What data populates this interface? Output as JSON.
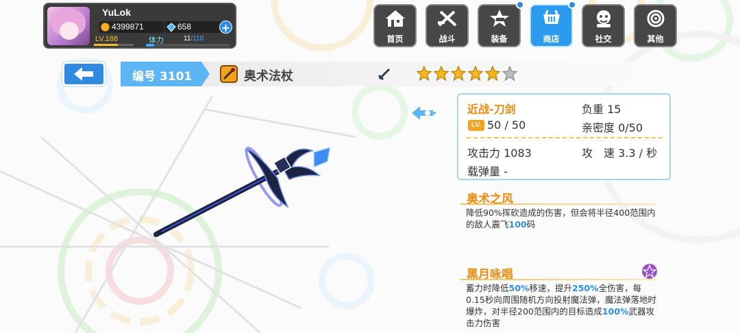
{
  "player": {
    "name": "YuLok",
    "gold": "4399871",
    "gems": "658",
    "level": "LV.188",
    "level_progress": 0.6,
    "stamina_label": "体力",
    "stamina_current": "11",
    "stamina_max": "/110",
    "stamina_progress": 0.1
  },
  "nav": [
    {
      "label": "首页",
      "icon": "home-icon"
    },
    {
      "label": "战斗",
      "icon": "battle-icon"
    },
    {
      "label": "装备",
      "icon": "equipment-icon"
    },
    {
      "label": "商店",
      "icon": "shop-icon",
      "active": true
    },
    {
      "label": "社交",
      "icon": "social-icon"
    },
    {
      "label": "其他",
      "icon": "other-icon"
    }
  ],
  "item": {
    "id_label": "编号 3101",
    "name": "奥术法杖",
    "stars": 5,
    "max_stars": 6
  },
  "stats": {
    "type": "近战-刀剑",
    "weight": "负重 15",
    "lv_badge": "LV.",
    "level": "50 / 50",
    "affinity": "亲密度 0/50",
    "attack": "攻击力 1083",
    "attack_speed": "攻　速 3.3 / 秒",
    "ammo": "载弹量 -"
  },
  "skills": [
    {
      "title": "奥术之风",
      "desc_parts": [
        {
          "t": "降低90%挥砍造成的伤害，但会将半径400范围内的敌人震飞"
        },
        {
          "t": "100",
          "hl": true
        },
        {
          "t": "码"
        }
      ]
    },
    {
      "title": "黑月咏唱",
      "desc_parts": [
        {
          "t": "蓄力时降低"
        },
        {
          "t": "50%",
          "hl": true
        },
        {
          "t": "移速，提升"
        },
        {
          "t": "250%",
          "hl": true
        },
        {
          "t": "全伤害，每0.15秒向周围随机方向投射魔法弹，魔法弹落地时爆炸，对半径200范围内的目标造成"
        },
        {
          "t": "100%",
          "hl": true
        },
        {
          "t": "武器攻击力伤害"
        }
      ]
    }
  ],
  "colors": {
    "accent": "#2f8ae0",
    "orange": "#f08a0a",
    "highlight": "#2e8fe6"
  }
}
